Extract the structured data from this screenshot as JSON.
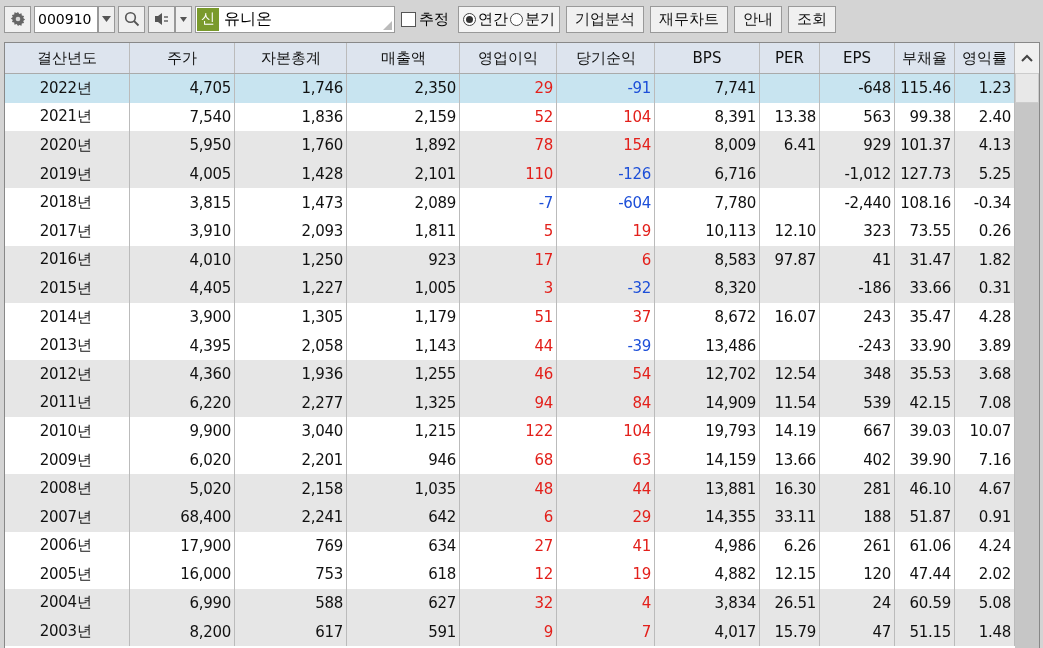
{
  "toolbar": {
    "code": "000910",
    "badge": "신",
    "name": "유니온",
    "estimate": {
      "label": "추정",
      "checked": false
    },
    "periods": [
      {
        "label": "연간",
        "selected": true
      },
      {
        "label": "분기",
        "selected": false
      }
    ],
    "buttons": [
      "기업분석",
      "재무차트",
      "안내",
      "조회"
    ]
  },
  "table": {
    "columns": [
      "결산년도",
      "주가",
      "자본총계",
      "매출액",
      "영업이익",
      "당기순익",
      "BPS",
      "PER",
      "EPS",
      "부채율",
      "영익률"
    ],
    "rows": [
      {
        "selected": true,
        "op_loss": false,
        "net_loss": true,
        "cells": [
          "2022년",
          "4,705",
          "1,746",
          "2,350",
          "29",
          "-91",
          "7,741",
          null,
          "-648",
          "115.46",
          "1.23"
        ]
      },
      {
        "selected": false,
        "op_loss": false,
        "net_loss": false,
        "cells": [
          "2021년",
          "7,540",
          "1,836",
          "2,159",
          "52",
          "104",
          "8,391",
          "13.38",
          "563",
          "99.38",
          "2.40"
        ]
      },
      {
        "selected": false,
        "op_loss": false,
        "net_loss": false,
        "cells": [
          "2020년",
          "5,950",
          "1,760",
          "1,892",
          "78",
          "154",
          "8,009",
          "6.41",
          "929",
          "101.37",
          "4.13"
        ]
      },
      {
        "selected": false,
        "op_loss": false,
        "net_loss": true,
        "cells": [
          "2019년",
          "4,005",
          "1,428",
          "2,101",
          "110",
          "-126",
          "6,716",
          null,
          "-1,012",
          "127.73",
          "5.25"
        ]
      },
      {
        "selected": false,
        "op_loss": true,
        "net_loss": true,
        "cells": [
          "2018년",
          "3,815",
          "1,473",
          "2,089",
          "-7",
          "-604",
          "7,780",
          null,
          "-2,440",
          "108.16",
          "-0.34"
        ]
      },
      {
        "selected": false,
        "op_loss": false,
        "net_loss": false,
        "cells": [
          "2017년",
          "3,910",
          "2,093",
          "1,811",
          "5",
          "19",
          "10,113",
          "12.10",
          "323",
          "73.55",
          "0.26"
        ]
      },
      {
        "selected": false,
        "op_loss": false,
        "net_loss": false,
        "cells": [
          "2016년",
          "4,010",
          "1,250",
          "923",
          "17",
          "6",
          "8,583",
          "97.87",
          "41",
          "31.47",
          "1.82"
        ]
      },
      {
        "selected": false,
        "op_loss": false,
        "net_loss": true,
        "cells": [
          "2015년",
          "4,405",
          "1,227",
          "1,005",
          "3",
          "-32",
          "8,320",
          null,
          "-186",
          "33.66",
          "0.31"
        ]
      },
      {
        "selected": false,
        "op_loss": false,
        "net_loss": false,
        "cells": [
          "2014년",
          "3,900",
          "1,305",
          "1,179",
          "51",
          "37",
          "8,672",
          "16.07",
          "243",
          "35.47",
          "4.28"
        ]
      },
      {
        "selected": false,
        "op_loss": false,
        "net_loss": true,
        "cells": [
          "2013년",
          "4,395",
          "2,058",
          "1,143",
          "44",
          "-39",
          "13,486",
          null,
          "-243",
          "33.90",
          "3.89"
        ]
      },
      {
        "selected": false,
        "op_loss": false,
        "net_loss": false,
        "cells": [
          "2012년",
          "4,360",
          "1,936",
          "1,255",
          "46",
          "54",
          "12,702",
          "12.54",
          "348",
          "35.53",
          "3.68"
        ]
      },
      {
        "selected": false,
        "op_loss": false,
        "net_loss": false,
        "cells": [
          "2011년",
          "6,220",
          "2,277",
          "1,325",
          "94",
          "84",
          "14,909",
          "11.54",
          "539",
          "42.15",
          "7.08"
        ]
      },
      {
        "selected": false,
        "op_loss": false,
        "net_loss": false,
        "cells": [
          "2010년",
          "9,900",
          "3,040",
          "1,215",
          "122",
          "104",
          "19,793",
          "14.19",
          "667",
          "39.03",
          "10.07"
        ]
      },
      {
        "selected": false,
        "op_loss": false,
        "net_loss": false,
        "cells": [
          "2009년",
          "6,020",
          "2,201",
          "946",
          "68",
          "63",
          "14,159",
          "13.66",
          "402",
          "39.90",
          "7.16"
        ]
      },
      {
        "selected": false,
        "op_loss": false,
        "net_loss": false,
        "cells": [
          "2008년",
          "5,020",
          "2,158",
          "1,035",
          "48",
          "44",
          "13,881",
          "16.30",
          "281",
          "46.10",
          "4.67"
        ]
      },
      {
        "selected": false,
        "op_loss": false,
        "net_loss": false,
        "cells": [
          "2007년",
          "68,400",
          "2,241",
          "642",
          "6",
          "29",
          "14,355",
          "33.11",
          "188",
          "51.87",
          "0.91"
        ]
      },
      {
        "selected": false,
        "op_loss": false,
        "net_loss": false,
        "cells": [
          "2006년",
          "17,900",
          "769",
          "634",
          "27",
          "41",
          "4,986",
          "6.26",
          "261",
          "61.06",
          "4.24"
        ]
      },
      {
        "selected": false,
        "op_loss": false,
        "net_loss": false,
        "cells": [
          "2005년",
          "16,000",
          "753",
          "618",
          "12",
          "19",
          "4,882",
          "12.15",
          "120",
          "47.44",
          "2.02"
        ]
      },
      {
        "selected": false,
        "op_loss": false,
        "net_loss": false,
        "cells": [
          "2004년",
          "6,990",
          "588",
          "627",
          "32",
          "4",
          "3,834",
          "26.51",
          "24",
          "60.59",
          "5.08"
        ]
      },
      {
        "selected": false,
        "op_loss": false,
        "net_loss": false,
        "cells": [
          "2003년",
          "8,200",
          "617",
          "591",
          "9",
          "7",
          "4,017",
          "15.79",
          "47",
          "51.15",
          "1.48"
        ]
      }
    ]
  }
}
